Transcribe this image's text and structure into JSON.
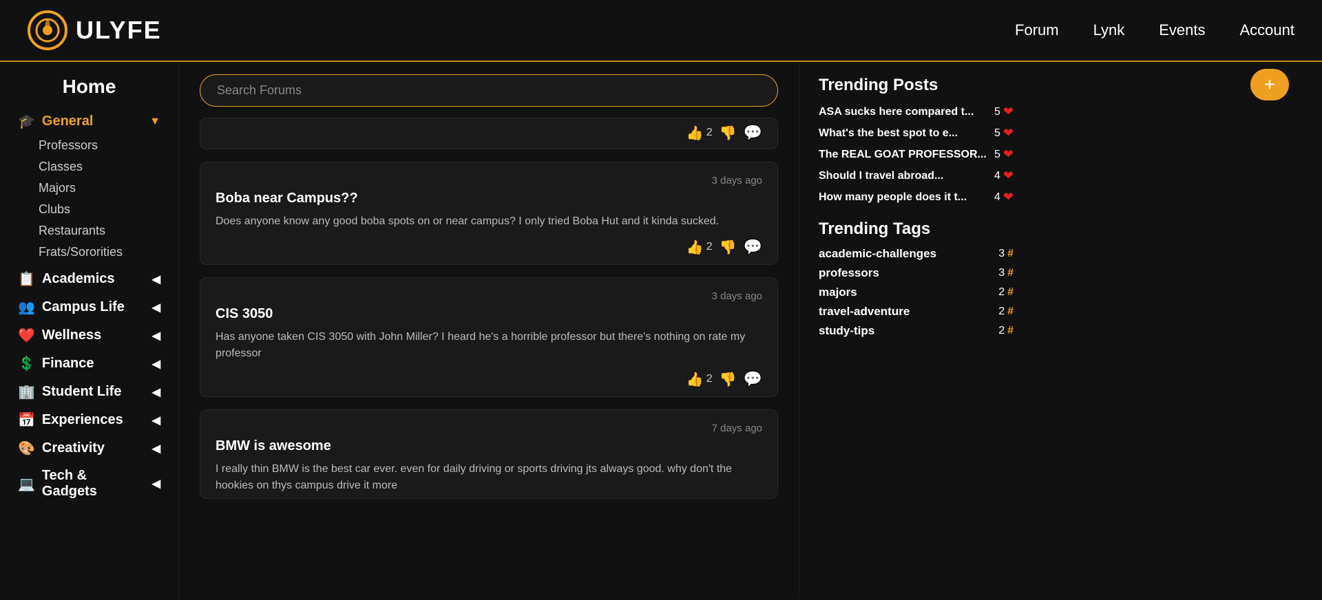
{
  "header": {
    "logo_text": "ULYFE",
    "nav": [
      {
        "label": "Forum",
        "key": "forum"
      },
      {
        "label": "Lynk",
        "key": "lynk"
      },
      {
        "label": "Events",
        "key": "events"
      },
      {
        "label": "Account",
        "key": "account"
      }
    ]
  },
  "sidebar": {
    "home_label": "Home",
    "sections": [
      {
        "key": "general",
        "icon": "🎓",
        "label": "General",
        "expanded": true,
        "sub_items": [
          "Professors",
          "Classes",
          "Majors",
          "Clubs",
          "Restaurants",
          "Frats/Sororities"
        ]
      },
      {
        "key": "academics",
        "icon": "📋",
        "label": "Academics",
        "expanded": false
      },
      {
        "key": "campus-life",
        "icon": "👥",
        "label": "Campus Life",
        "expanded": false
      },
      {
        "key": "wellness",
        "icon": "❤️",
        "label": "Wellness",
        "expanded": false
      },
      {
        "key": "finance",
        "icon": "💲",
        "label": "Finance",
        "expanded": false
      },
      {
        "key": "student-life",
        "icon": "🏢",
        "label": "Student Life",
        "expanded": false
      },
      {
        "key": "experiences",
        "icon": "📅",
        "label": "Experiences",
        "expanded": false
      },
      {
        "key": "creativity",
        "icon": "🎨",
        "label": "Creativity",
        "expanded": false
      },
      {
        "key": "tech-gadgets",
        "icon": "💻",
        "label": "Tech & Gadgets",
        "expanded": false
      }
    ]
  },
  "search": {
    "placeholder": "Search Forums"
  },
  "posts": [
    {
      "key": "post-1",
      "time_ago": "",
      "title": "",
      "body": "",
      "likes": 2,
      "show_body": false
    },
    {
      "key": "post-boba",
      "time_ago": "3 days ago",
      "title": "Boba near Campus??",
      "body": "Does anyone know any good boba spots on or near campus? I only tried Boba Hut and it kinda sucked.",
      "likes": 2
    },
    {
      "key": "post-cis3050",
      "time_ago": "3 days ago",
      "title": "CIS 3050",
      "body": "Has anyone taken CIS 3050 with John Miller? I heard he's a horrible professor but there's nothing on rate my professor",
      "likes": 2
    },
    {
      "key": "post-bmw",
      "time_ago": "7 days ago",
      "title": "BMW is awesome",
      "body": "I really thin BMW is the best car ever. even for daily driving or sports driving jts always good. why don't the hookies on thys campus drive it more",
      "likes": null
    }
  ],
  "trending": {
    "posts_title": "Trending Posts",
    "posts": [
      {
        "label": "ASA sucks here compared t...",
        "count": 5
      },
      {
        "label": "What's the best spot to e...",
        "count": 5
      },
      {
        "label": "The REAL GOAT PROFESSOR...",
        "count": 5
      },
      {
        "label": "Should I travel abroad...",
        "count": 4
      },
      {
        "label": "How many people does it t...",
        "count": 4
      }
    ],
    "tags_title": "Trending Tags",
    "tags": [
      {
        "label": "academic-challenges",
        "count": 3
      },
      {
        "label": "professors",
        "count": 3
      },
      {
        "label": "majors",
        "count": 2
      },
      {
        "label": "travel-adventure",
        "count": 2
      },
      {
        "label": "study-tips",
        "count": 2
      }
    ]
  },
  "fab": {
    "label": "+"
  }
}
